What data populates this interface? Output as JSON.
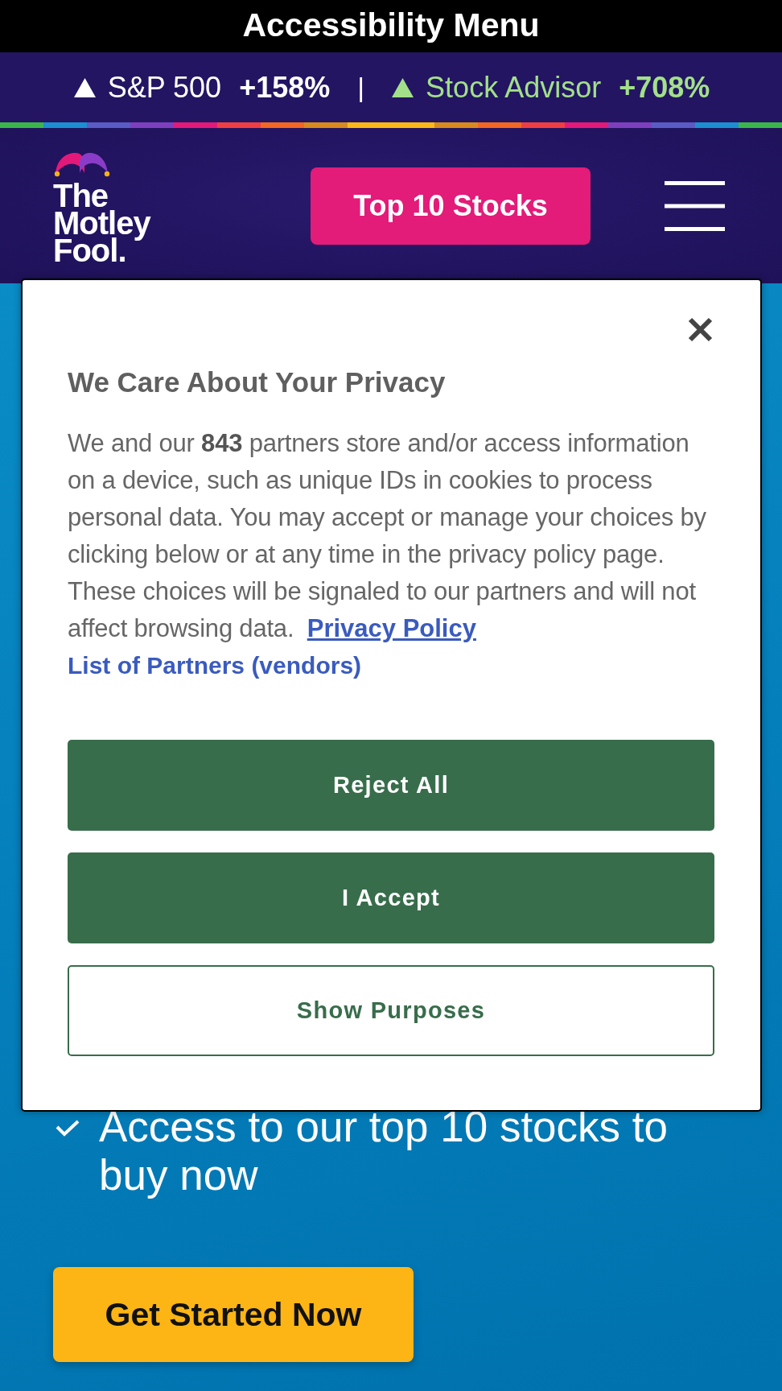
{
  "accessibility_bar": {
    "label": "Accessibility Menu"
  },
  "ticker": {
    "items": [
      {
        "label": "S&P 500",
        "change": "+158%",
        "color": "#ffffff"
      },
      {
        "label": "Stock Advisor",
        "change": "+708%",
        "color": "#a3e08a"
      }
    ],
    "separator": "|"
  },
  "header": {
    "logo": "The Motley Fool.",
    "cta": "Top 10 Stocks"
  },
  "consent_dialog": {
    "title": "We Care About Your Privacy",
    "text": "We and our **843** partners store and/or access information on a device, such as unique IDs in cookies to process personal data. You may accept or manage your choices by clicking below or at any time in the privacy policy page. These choices will be signaled to our partners and will not affect browsing data.",
    "privacy_link": "Privacy Policy",
    "partners_link": "List of Partners (vendors)",
    "buttons": [
      {
        "label": "Reject All",
        "kind": "primary"
      },
      {
        "label": "I Accept",
        "kind": "primary"
      },
      {
        "label": "Show Purposes",
        "kind": "outline"
      }
    ]
  },
  "hero": {
    "benefits": [
      "Access to our top 10 stocks to buy now"
    ],
    "button": "Get Started Now"
  }
}
